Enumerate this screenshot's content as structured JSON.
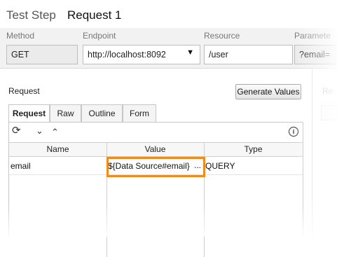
{
  "title": {
    "kind": "Test Step",
    "name": "Request 1"
  },
  "fields": {
    "method": {
      "label": "Method",
      "value": "GET"
    },
    "endpoint": {
      "label": "Endpoint",
      "value": "http://localhost:8092"
    },
    "resource": {
      "label": "Resource",
      "value": "/user"
    },
    "parameters": {
      "label": "Paramete",
      "value": "?email="
    }
  },
  "request_panel": {
    "title": "Request",
    "generate_button": "Generate Values",
    "tabs": [
      {
        "label": "Request",
        "active": true
      },
      {
        "label": "Raw",
        "active": false
      },
      {
        "label": "Outline",
        "active": false
      },
      {
        "label": "Form",
        "active": false
      }
    ],
    "toolbar_icons": [
      "refresh-icon",
      "chevron-down-icon",
      "chevron-up-icon",
      "info-icon"
    ],
    "grid": {
      "columns": [
        "Name",
        "Value",
        "Type"
      ],
      "rows": [
        {
          "name": "email",
          "value": "${Data Source#email}",
          "value_button": "...",
          "type": "QUERY"
        }
      ]
    }
  },
  "right_panel": {
    "label_fragment": "Re"
  },
  "colors": {
    "highlight": "#f08a1e",
    "fields_bg": "#f2f2f2"
  }
}
